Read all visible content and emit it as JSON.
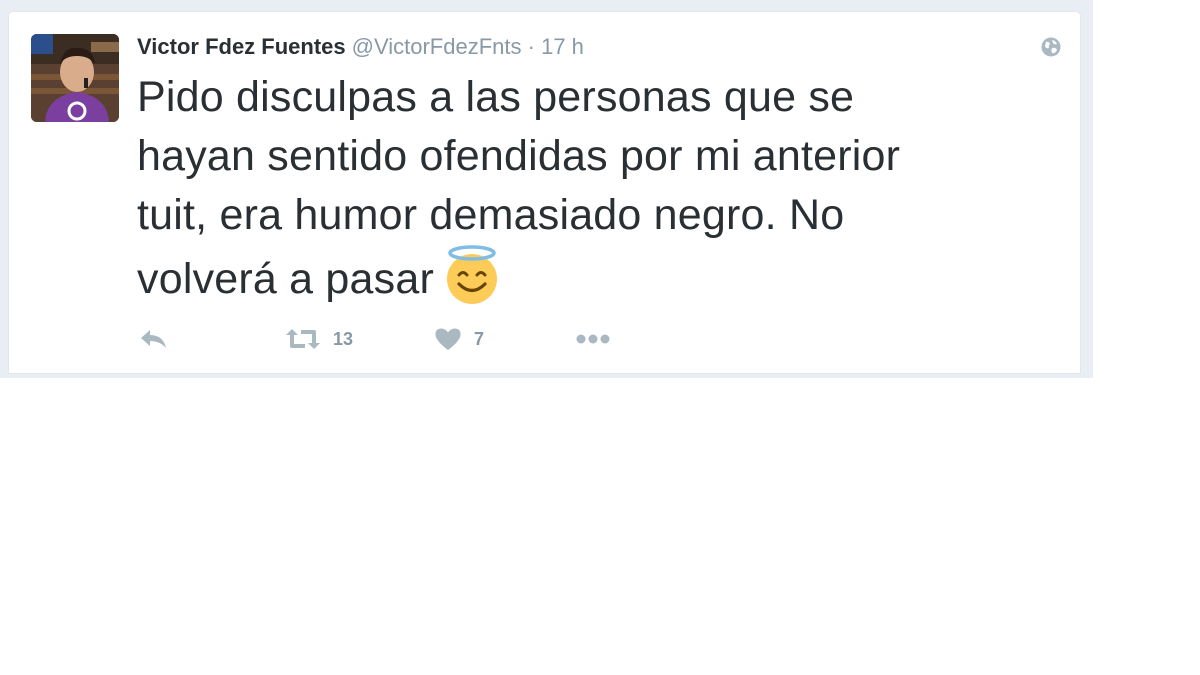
{
  "tweet": {
    "author": {
      "fullname": "Victor Fdez Fuentes",
      "username": "@VictorFdezFnts",
      "avatar_icon": "profile-photo"
    },
    "separator": "·",
    "timestamp": "17 h",
    "text": "Pido disculpas a las personas que se hayan sentido ofendidas por mi anterior tuit, era humor demasiado negro. No volverá a pasar",
    "text_lines": [
      "Pido disculpas a las personas que se",
      "hayan sentido ofendidas por mi anterior",
      "tuit, era humor demasiado negro. No",
      "volverá a pasar"
    ],
    "emoji": "smiling-face-with-halo",
    "visibility_icon": "globe-icon",
    "actions": {
      "reply": {
        "icon": "reply-icon"
      },
      "retweet": {
        "icon": "retweet-icon",
        "count": "13"
      },
      "like": {
        "icon": "heart-icon",
        "count": "7"
      },
      "more": {
        "icon": "more-icon"
      }
    }
  },
  "colors": {
    "text_primary": "#292f33",
    "text_secondary": "#8899a6",
    "background_timeline": "#e8eef3",
    "card_border": "#e1e8ed"
  }
}
